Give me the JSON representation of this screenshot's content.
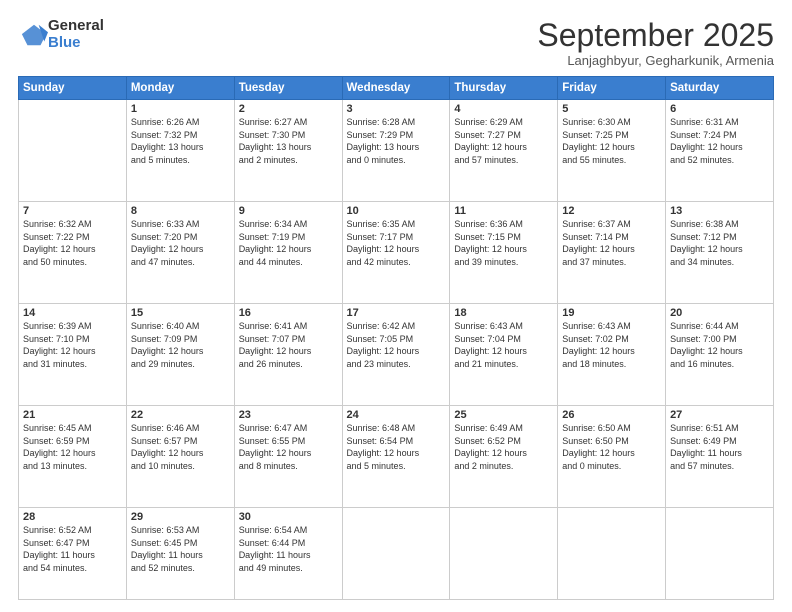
{
  "logo": {
    "general": "General",
    "blue": "Blue"
  },
  "header": {
    "month": "September 2025",
    "location": "Lanjaghbyur, Gegharkunik, Armenia"
  },
  "days_of_week": [
    "Sunday",
    "Monday",
    "Tuesday",
    "Wednesday",
    "Thursday",
    "Friday",
    "Saturday"
  ],
  "weeks": [
    [
      {
        "day": "",
        "info": ""
      },
      {
        "day": "1",
        "info": "Sunrise: 6:26 AM\nSunset: 7:32 PM\nDaylight: 13 hours\nand 5 minutes."
      },
      {
        "day": "2",
        "info": "Sunrise: 6:27 AM\nSunset: 7:30 PM\nDaylight: 13 hours\nand 2 minutes."
      },
      {
        "day": "3",
        "info": "Sunrise: 6:28 AM\nSunset: 7:29 PM\nDaylight: 13 hours\nand 0 minutes."
      },
      {
        "day": "4",
        "info": "Sunrise: 6:29 AM\nSunset: 7:27 PM\nDaylight: 12 hours\nand 57 minutes."
      },
      {
        "day": "5",
        "info": "Sunrise: 6:30 AM\nSunset: 7:25 PM\nDaylight: 12 hours\nand 55 minutes."
      },
      {
        "day": "6",
        "info": "Sunrise: 6:31 AM\nSunset: 7:24 PM\nDaylight: 12 hours\nand 52 minutes."
      }
    ],
    [
      {
        "day": "7",
        "info": "Sunrise: 6:32 AM\nSunset: 7:22 PM\nDaylight: 12 hours\nand 50 minutes."
      },
      {
        "day": "8",
        "info": "Sunrise: 6:33 AM\nSunset: 7:20 PM\nDaylight: 12 hours\nand 47 minutes."
      },
      {
        "day": "9",
        "info": "Sunrise: 6:34 AM\nSunset: 7:19 PM\nDaylight: 12 hours\nand 44 minutes."
      },
      {
        "day": "10",
        "info": "Sunrise: 6:35 AM\nSunset: 7:17 PM\nDaylight: 12 hours\nand 42 minutes."
      },
      {
        "day": "11",
        "info": "Sunrise: 6:36 AM\nSunset: 7:15 PM\nDaylight: 12 hours\nand 39 minutes."
      },
      {
        "day": "12",
        "info": "Sunrise: 6:37 AM\nSunset: 7:14 PM\nDaylight: 12 hours\nand 37 minutes."
      },
      {
        "day": "13",
        "info": "Sunrise: 6:38 AM\nSunset: 7:12 PM\nDaylight: 12 hours\nand 34 minutes."
      }
    ],
    [
      {
        "day": "14",
        "info": "Sunrise: 6:39 AM\nSunset: 7:10 PM\nDaylight: 12 hours\nand 31 minutes."
      },
      {
        "day": "15",
        "info": "Sunrise: 6:40 AM\nSunset: 7:09 PM\nDaylight: 12 hours\nand 29 minutes."
      },
      {
        "day": "16",
        "info": "Sunrise: 6:41 AM\nSunset: 7:07 PM\nDaylight: 12 hours\nand 26 minutes."
      },
      {
        "day": "17",
        "info": "Sunrise: 6:42 AM\nSunset: 7:05 PM\nDaylight: 12 hours\nand 23 minutes."
      },
      {
        "day": "18",
        "info": "Sunrise: 6:43 AM\nSunset: 7:04 PM\nDaylight: 12 hours\nand 21 minutes."
      },
      {
        "day": "19",
        "info": "Sunrise: 6:43 AM\nSunset: 7:02 PM\nDaylight: 12 hours\nand 18 minutes."
      },
      {
        "day": "20",
        "info": "Sunrise: 6:44 AM\nSunset: 7:00 PM\nDaylight: 12 hours\nand 16 minutes."
      }
    ],
    [
      {
        "day": "21",
        "info": "Sunrise: 6:45 AM\nSunset: 6:59 PM\nDaylight: 12 hours\nand 13 minutes."
      },
      {
        "day": "22",
        "info": "Sunrise: 6:46 AM\nSunset: 6:57 PM\nDaylight: 12 hours\nand 10 minutes."
      },
      {
        "day": "23",
        "info": "Sunrise: 6:47 AM\nSunset: 6:55 PM\nDaylight: 12 hours\nand 8 minutes."
      },
      {
        "day": "24",
        "info": "Sunrise: 6:48 AM\nSunset: 6:54 PM\nDaylight: 12 hours\nand 5 minutes."
      },
      {
        "day": "25",
        "info": "Sunrise: 6:49 AM\nSunset: 6:52 PM\nDaylight: 12 hours\nand 2 minutes."
      },
      {
        "day": "26",
        "info": "Sunrise: 6:50 AM\nSunset: 6:50 PM\nDaylight: 12 hours\nand 0 minutes."
      },
      {
        "day": "27",
        "info": "Sunrise: 6:51 AM\nSunset: 6:49 PM\nDaylight: 11 hours\nand 57 minutes."
      }
    ],
    [
      {
        "day": "28",
        "info": "Sunrise: 6:52 AM\nSunset: 6:47 PM\nDaylight: 11 hours\nand 54 minutes."
      },
      {
        "day": "29",
        "info": "Sunrise: 6:53 AM\nSunset: 6:45 PM\nDaylight: 11 hours\nand 52 minutes."
      },
      {
        "day": "30",
        "info": "Sunrise: 6:54 AM\nSunset: 6:44 PM\nDaylight: 11 hours\nand 49 minutes."
      },
      {
        "day": "",
        "info": ""
      },
      {
        "day": "",
        "info": ""
      },
      {
        "day": "",
        "info": ""
      },
      {
        "day": "",
        "info": ""
      }
    ]
  ]
}
